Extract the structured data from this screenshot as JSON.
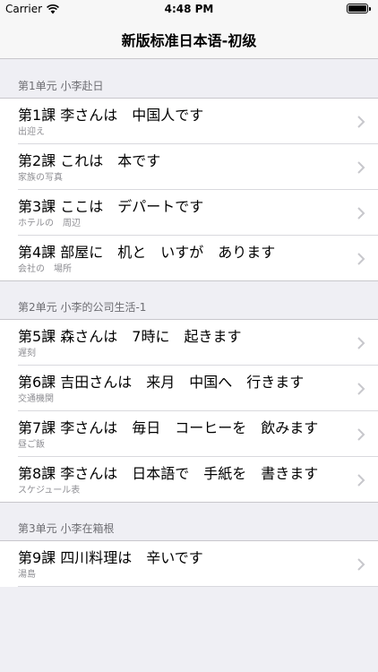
{
  "status_bar": {
    "carrier": "Carrier",
    "time": "4:48 PM"
  },
  "nav": {
    "title": "新版标准日本语-初级"
  },
  "sections": [
    {
      "header": "第1单元 小李赴日",
      "lessons": [
        {
          "title": "第1課 李さんは　中国人です",
          "subtitle": "出迎え"
        },
        {
          "title": "第2課 これは　本です",
          "subtitle": "家族の写真"
        },
        {
          "title": "第3課 ここは　デパートです",
          "subtitle": "ホテルの　周辺"
        },
        {
          "title": "第4課 部屋に　机と　いすが　あります",
          "subtitle": "会社の　場所"
        }
      ]
    },
    {
      "header": "第2单元 小李的公司生活-1",
      "lessons": [
        {
          "title": "第5課 森さんは　7時に　起きます",
          "subtitle": "遅刻"
        },
        {
          "title": "第6課 吉田さんは　来月　中国へ　行きます",
          "subtitle": "交通機関"
        },
        {
          "title": "第7課 李さんは　毎日　コーヒーを　飲みます",
          "subtitle": "昼ご飯"
        },
        {
          "title": "第8課 李さんは　日本語で　手紙を　書きます",
          "subtitle": "スケジュール表"
        }
      ]
    },
    {
      "header": "第3单元 小李在箱根",
      "lessons": [
        {
          "title": "第9課 四川料理は　辛いです",
          "subtitle": "湯島"
        }
      ]
    }
  ]
}
